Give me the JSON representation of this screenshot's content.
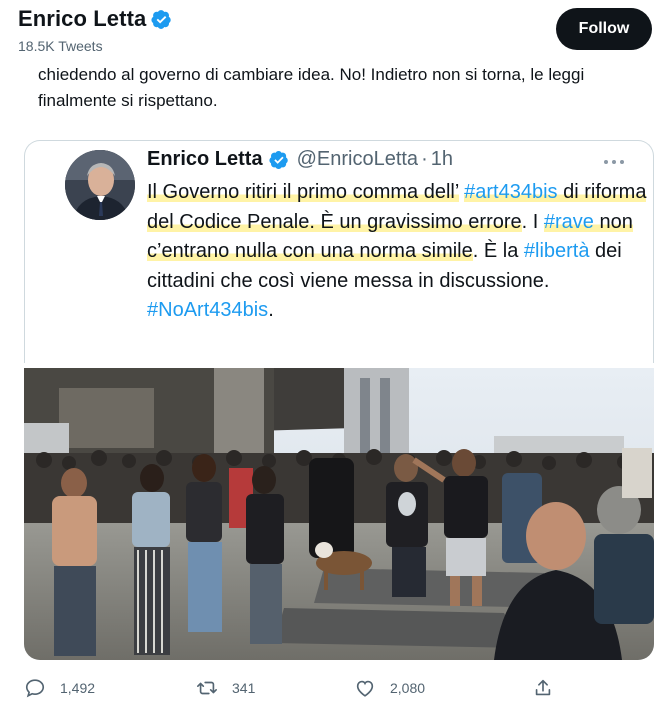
{
  "profile": {
    "name": "Enrico Letta",
    "tweet_count": "18.5K Tweets",
    "follow_label": "Follow"
  },
  "tweet": {
    "text": "chiedendo al governo di cambiare idea. No! Indietro non si torna, le leggi finalmente si rispettano."
  },
  "quoted": {
    "name": "Enrico Letta",
    "handle": "@EnricoLetta",
    "separator": "·",
    "time": "1h",
    "segments": [
      {
        "t": "Il Governo ritiri il primo comma dell’",
        "style": "hl"
      },
      {
        "t": " ",
        "style": "plain"
      },
      {
        "t": "#art434bis",
        "style": "tag-hl"
      },
      {
        "t": " di riforma del Codice Penale. È un gravissimo errore",
        "style": "hl"
      },
      {
        "t": ". I ",
        "style": "plain"
      },
      {
        "t": "#rave",
        "style": "tag-hl"
      },
      {
        "t": " non c’entrano nulla con una norma simile",
        "style": "hl"
      },
      {
        "t": ". È la ",
        "style": "plain"
      },
      {
        "t": "#libertà",
        "style": "tag"
      },
      {
        "t": " dei cittadini che così viene messa in discussione. ",
        "style": "plain"
      },
      {
        "t": "#NoArt434bis",
        "style": "tag"
      },
      {
        "t": ".",
        "style": "plain"
      }
    ],
    "photo_description_icon": "crowd-photo"
  },
  "actions": {
    "replies": "1,492",
    "retweets": "341",
    "likes": "2,080"
  },
  "colors": {
    "accent": "#1d9bf0",
    "text": "#0f1419",
    "muted": "#536471",
    "highlight": "#fff3a6"
  }
}
